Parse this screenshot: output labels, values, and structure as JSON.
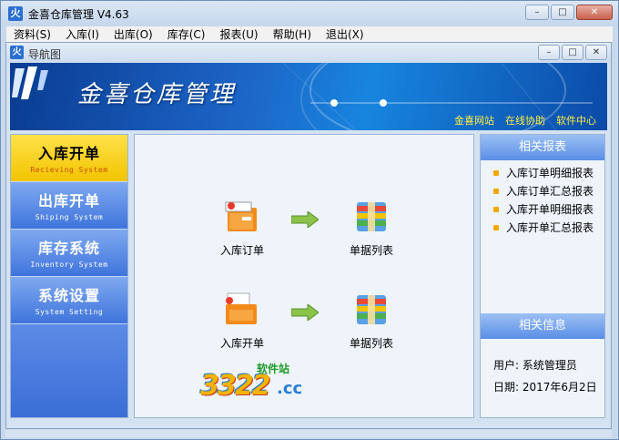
{
  "window": {
    "title": "金喜仓库管理 V4.63",
    "icon": "app-logo-icon",
    "buttons": [
      "minimize",
      "maximize",
      "close"
    ]
  },
  "menubar": {
    "items": [
      "资料(S)",
      "入库(I)",
      "出库(O)",
      "库存(C)",
      "报表(U)",
      "帮助(H)",
      "退出(X)"
    ]
  },
  "child_window": {
    "title": "导航图"
  },
  "banner": {
    "title": "金喜仓库管理",
    "links": [
      "金喜网站",
      "在线协助",
      "软件中心"
    ]
  },
  "nav": {
    "items": [
      {
        "label": "入库开单",
        "sub": "Recieving System",
        "active": true
      },
      {
        "label": "出库开单",
        "sub": "Shiping System",
        "active": false
      },
      {
        "label": "库存系统",
        "sub": "Inventory System",
        "active": false
      },
      {
        "label": "系统设置",
        "sub": "System Setting",
        "active": false
      }
    ]
  },
  "flow": {
    "row1": {
      "from": "入库订单",
      "to": "单据列表"
    },
    "row2": {
      "from": "入库开单",
      "to": "单据列表"
    }
  },
  "watermark": {
    "number": "3322",
    "cn": "软件站",
    "domain": ".cc"
  },
  "reports": {
    "header": "相关报表",
    "items": [
      "入库订单明细报表",
      "入库订单汇总报表",
      "入库开单明细报表",
      "入库开单汇总报表"
    ]
  },
  "info": {
    "header": "相关信息",
    "user_label": "用户:",
    "user_value": "系统管理员",
    "date_label": "日期:",
    "date_value": "2017年6月2日"
  },
  "colors": {
    "nav_active": "#f2c400",
    "nav_bg": "#3f74dc",
    "banner": "#1d66c8",
    "link": "#ffee44"
  }
}
